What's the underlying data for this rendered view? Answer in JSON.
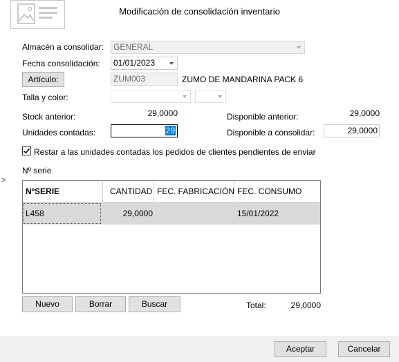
{
  "window": {
    "title": "Modificación de consolidación inventario"
  },
  "form": {
    "almacen_label": "Almacén a consolidar:",
    "almacen_value": "GENERAL",
    "fecha_label": "Fecha consolidación:",
    "fecha_value": "01/01/2023",
    "articulo_button": "Artículo:",
    "articulo_code": "ZUM003",
    "articulo_desc": "ZUMO DE MANDARINA PACK 6",
    "talla_label": "Talla y color:",
    "talla_value": "",
    "color_value": "",
    "stock_label": "Stock anterior:",
    "stock_value": "29,0000",
    "disp_anterior_label": "Disponible anterior:",
    "disp_anterior_value": "29,0000",
    "unidades_label": "Unidades contadas:",
    "unidades_value": "29",
    "disp_consolidar_label": "Disponible a consolidar:",
    "disp_consolidar_value": "29,0000",
    "restar_label": "Restar a las unidades contadas los pedidos de clientes pendientes de enviar",
    "restar_checked": true,
    "nserie_label": "Nº serie",
    "side_marker": ">"
  },
  "grid": {
    "columns": [
      "NºSERIE",
      "CANTIDAD",
      "FEC. FABRICACIÓN",
      "FEC. CONSUMO"
    ],
    "rows": [
      {
        "serie": "L458",
        "cantidad": "29,0000",
        "fabricacion": "",
        "consumo": "15/01/2022"
      }
    ]
  },
  "grid_buttons": {
    "nuevo": "Nuevo",
    "borrar": "Borrar",
    "buscar": "Buscar"
  },
  "total": {
    "label": "Total:",
    "value": "29,0000"
  },
  "footer": {
    "aceptar": "Aceptar",
    "cancelar": "Cancelar"
  },
  "colors": {
    "selection": "#0078d7",
    "row_bg": "#d9d9d9",
    "disabled_bg": "#f0f0f0"
  }
}
